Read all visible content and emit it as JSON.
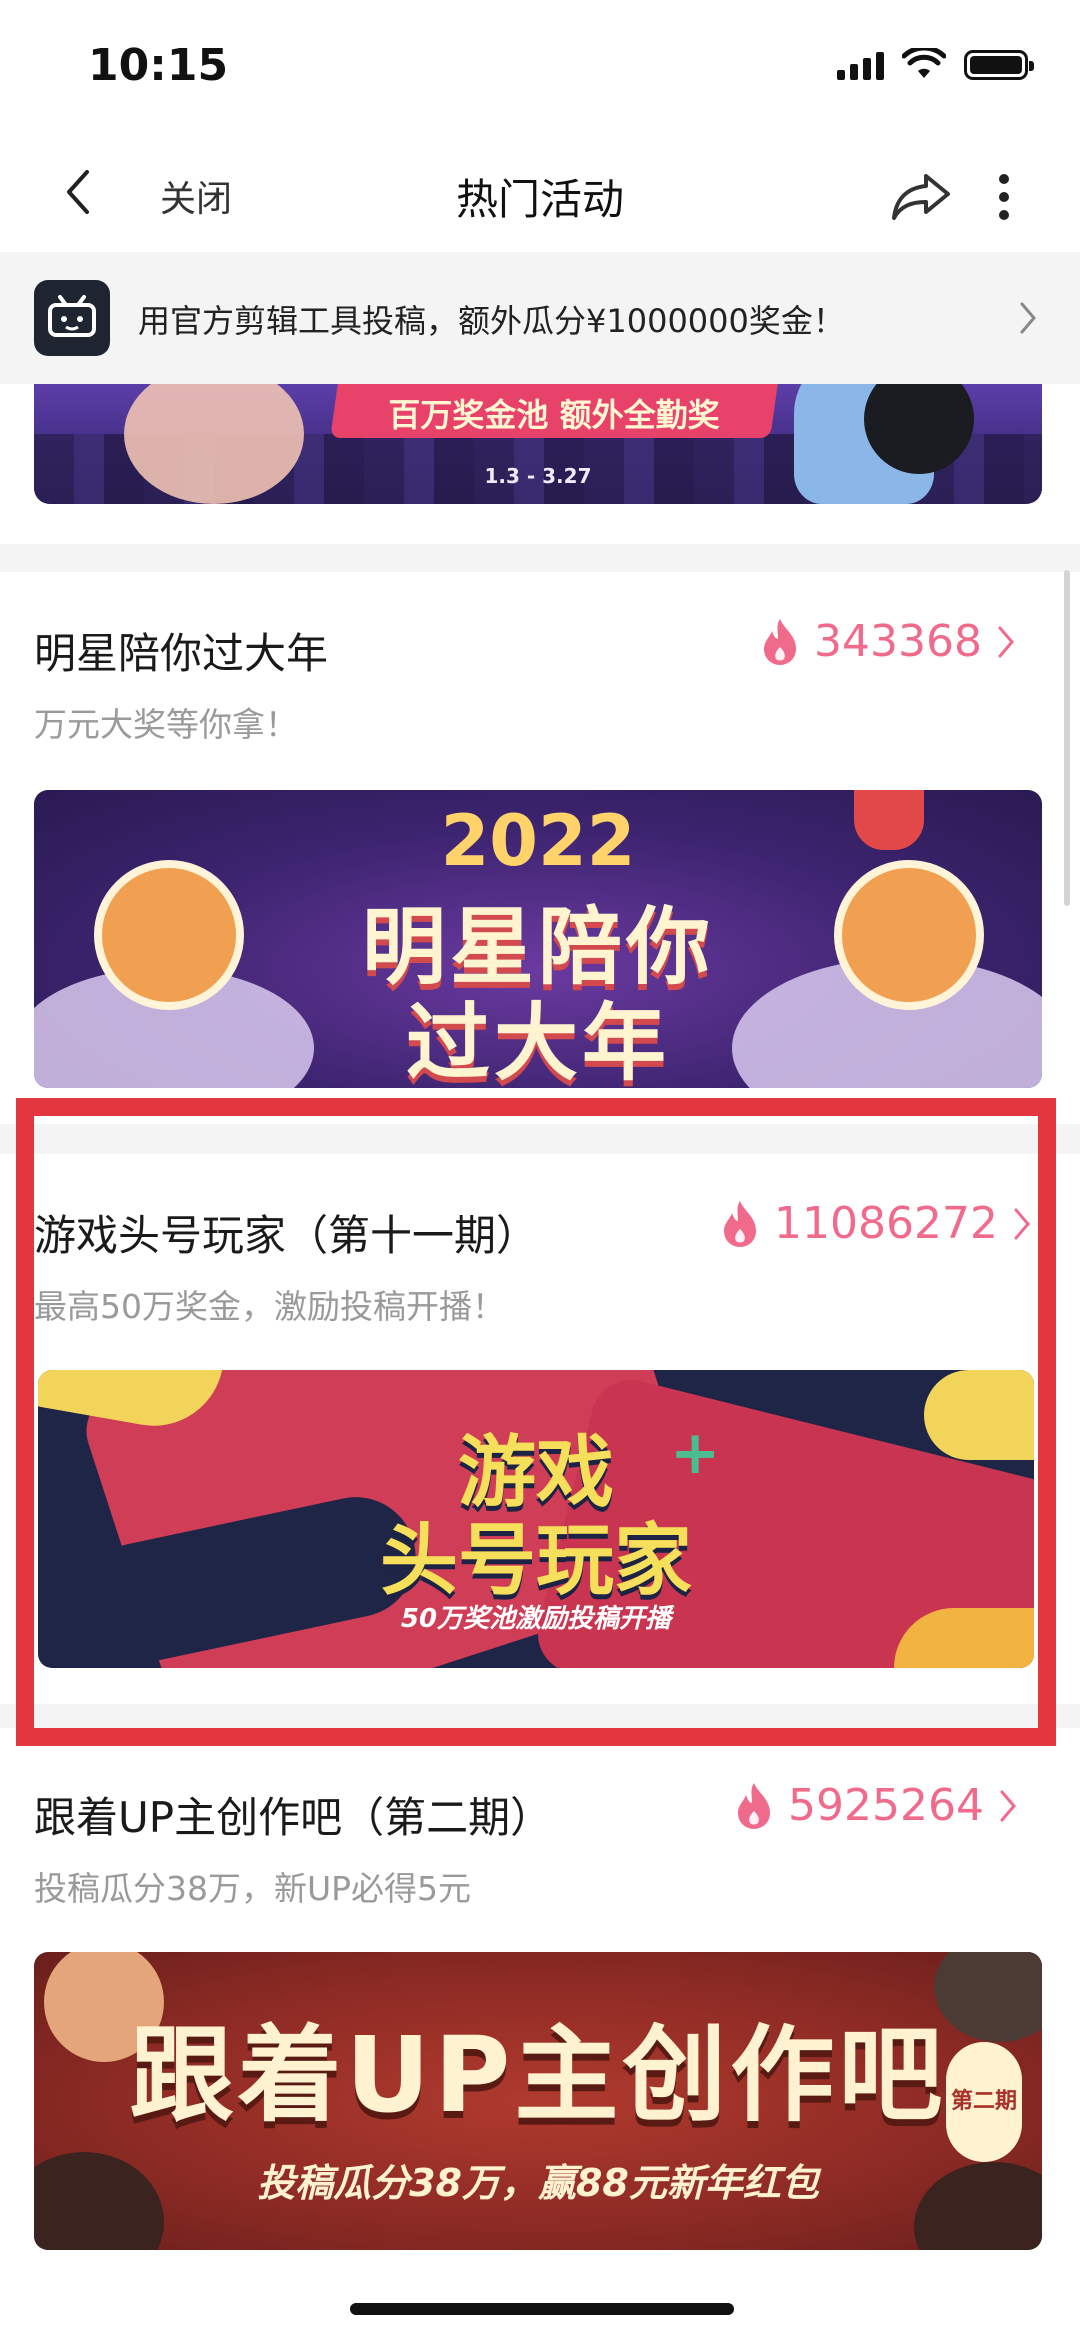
{
  "status_bar": {
    "time": "10:15"
  },
  "nav": {
    "close_label": "关闭",
    "title": "热门活动"
  },
  "promo": {
    "text": "用官方剪辑工具投稿，额外瓜分¥1000000奖金！"
  },
  "top_banner": {
    "ribbon_text": "百万奖金池 额外全勤奖",
    "dates": "1.3 - 3.27"
  },
  "activities": [
    {
      "title": "明星陪你过大年",
      "subtitle": "万元大奖等你拿！",
      "hot_count": "343368",
      "banner": {
        "year": "2022",
        "line1": "明星陪你",
        "line2": "过大年"
      }
    },
    {
      "title": "游戏头号玩家（第十一期）",
      "subtitle": "最高50万奖金，激励投稿开播！",
      "hot_count": "11086272",
      "banner": {
        "line1": "游戏",
        "line2": "头号玩家",
        "tagline": "50万奖池激励投稿开播"
      }
    },
    {
      "title": "跟着UP主创作吧（第二期）",
      "subtitle": "投稿瓜分38万，新UP必得5元",
      "hot_count": "5925264",
      "banner": {
        "line1": "跟着UP主创作吧",
        "tagline": "投稿瓜分38万，赢88元新年红包",
        "badge": "第二期"
      }
    }
  ],
  "colors": {
    "hot": "#f06a8c",
    "highlight": "#e2373e"
  },
  "icons": [
    "back-icon",
    "share-icon",
    "more-icon",
    "chevron-right-icon",
    "flame-icon",
    "editor-logo-icon"
  ]
}
